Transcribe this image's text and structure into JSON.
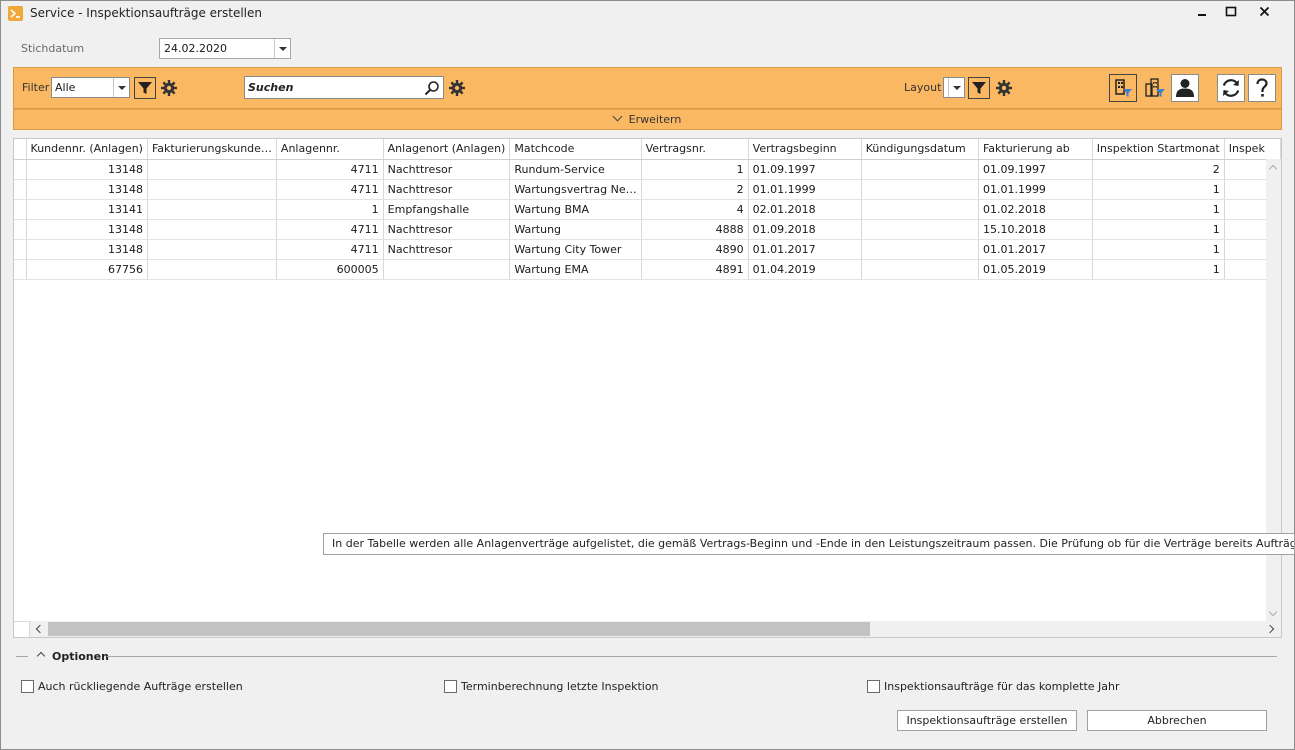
{
  "window": {
    "title": "Service - Inspektionsaufträge erstellen"
  },
  "stichdatum": {
    "label": "Stichdatum",
    "value": "24.02.2020"
  },
  "toolbar": {
    "filter_label": "Filter",
    "filter_value": "Alle",
    "search_placeholder": "Suchen",
    "layout_label": "Layout",
    "layout_value": "",
    "expand_label": "Erweitern",
    "accent_color": "#fbb862"
  },
  "table": {
    "columns": [
      "Kundennr. (Anlagen)",
      "Fakturierungskunde…",
      "Anlagennr.",
      "Anlagenort (Anlagen)",
      "Matchcode",
      "Vertragsnr.",
      "Vertragsbeginn",
      "Kündigungsdatum",
      "Fakturierung ab",
      "Inspektion Startmonat",
      "Inspek"
    ],
    "rows": [
      [
        "13148",
        "",
        "4711",
        "Nachttresor",
        "Rundum-Service",
        "1",
        "01.09.1997",
        "",
        "01.09.1997",
        "2",
        ""
      ],
      [
        "13148",
        "",
        "4711",
        "Nachttresor",
        "Wartungsvertrag Ne…",
        "2",
        "01.01.1999",
        "",
        "01.01.1999",
        "1",
        ""
      ],
      [
        "13141",
        "",
        "1",
        "Empfangshalle",
        "Wartung BMA",
        "4",
        "02.01.2018",
        "",
        "01.02.2018",
        "1",
        ""
      ],
      [
        "13148",
        "",
        "4711",
        "Nachttresor",
        "Wartung",
        "4888",
        "01.09.2018",
        "",
        "15.10.2018",
        "1",
        ""
      ],
      [
        "13148",
        "",
        "4711",
        "Nachttresor",
        "Wartung City Tower",
        "4890",
        "01.01.2017",
        "",
        "01.01.2017",
        "1",
        ""
      ],
      [
        "67756",
        "",
        "600005",
        "",
        "Wartung EMA",
        "4891",
        "01.04.2019",
        "",
        "01.05.2019",
        "1",
        ""
      ]
    ]
  },
  "tooltip": {
    "text": "In der Tabelle werden alle Anlagenverträge aufgelistet, die gemäß Vertrags-Beginn und -Ende in den Leistungszeitraum passen. Die Prüfung ob für die Verträge bereits Aufträge für de"
  },
  "options": {
    "title": "Optionen",
    "checkboxes": [
      "Auch rückliegende Aufträge erstellen",
      "Terminberechnung letzte Inspektion",
      "Inspektionsaufträge für das komplette Jahr"
    ]
  },
  "buttons": {
    "create": "Inspektionsaufträge erstellen",
    "cancel": "Abbrechen"
  }
}
